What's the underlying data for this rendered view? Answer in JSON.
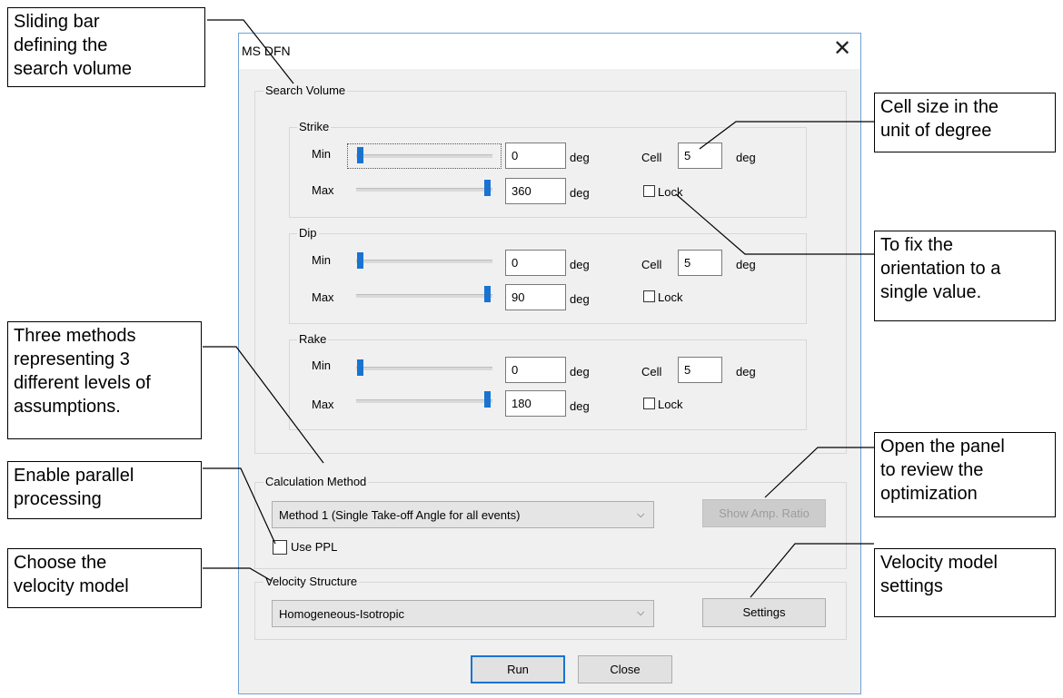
{
  "window": {
    "title": "MS DFN",
    "close_glyph": "✕"
  },
  "search_volume": {
    "label": "Search Volume",
    "strike": {
      "label": "Strike",
      "min_label": "Min",
      "max_label": "Max",
      "min_value": "0",
      "max_value": "360",
      "unit": "deg",
      "cell_label": "Cell",
      "cell_value": "5",
      "lock_label": "Lock"
    },
    "dip": {
      "label": "Dip",
      "min_label": "Min",
      "max_label": "Max",
      "min_value": "0",
      "max_value": "90",
      "unit": "deg",
      "cell_label": "Cell",
      "cell_value": "5",
      "lock_label": "Lock"
    },
    "rake": {
      "label": "Rake",
      "min_label": "Min",
      "max_label": "Max",
      "min_value": "0",
      "max_value": "180",
      "unit": "deg",
      "cell_label": "Cell",
      "cell_value": "5",
      "lock_label": "Lock"
    }
  },
  "calculation": {
    "label": "Calculation Method",
    "selected": "Method 1 (Single Take-off Angle for all events)",
    "use_ppl_label": "Use PPL",
    "show_amp_label": "Show Amp. Ratio"
  },
  "velocity": {
    "label": "Velocity Structure",
    "selected": "Homogeneous-Isotropic",
    "settings_label": "Settings"
  },
  "buttons": {
    "run": "Run",
    "close": "Close"
  },
  "callouts": {
    "sliding_bar": "Sliding bar\ndefining the\nsearch volume",
    "cell_size": "Cell size in the\nunit of degree",
    "fix_orientation": "To fix the\norientation to a\nsingle value.",
    "three_methods": "Three methods\nrepresenting 3\ndifferent levels of\nassumptions.",
    "parallel": "Enable parallel\nprocessing",
    "open_panel": "Open the panel\nto review the\noptimization",
    "choose_velocity": "Choose the\nvelocity model",
    "velocity_settings": "Velocity model\nsettings"
  },
  "icons": {
    "dropdown": "chevron-down-icon",
    "close": "close-icon",
    "checkbox": "checkbox-icon"
  },
  "colors": {
    "accent": "#1a73d1",
    "dialog_bg": "#f0f0f0",
    "window_border": "#6ea2d6"
  }
}
